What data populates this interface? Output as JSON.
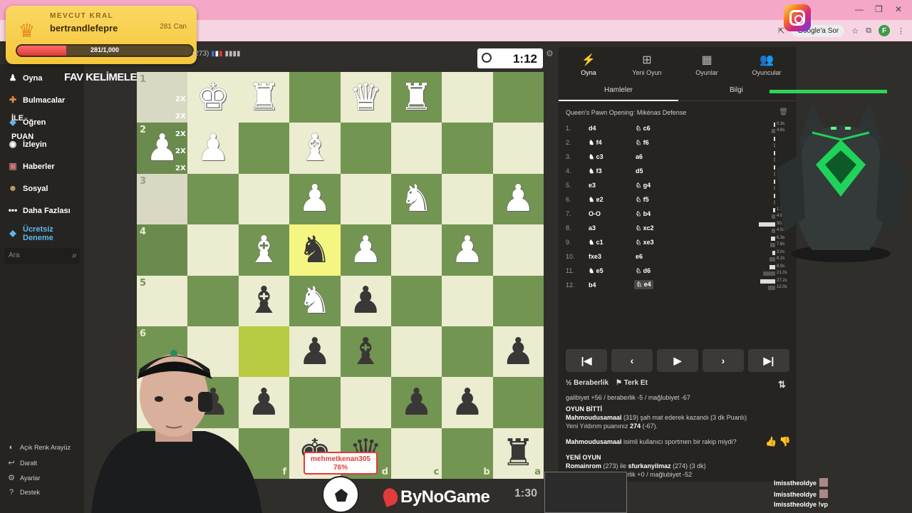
{
  "king_overlay": {
    "title": "MEVCUT KRAL",
    "name": "bertrandlefepre",
    "hp_label": "281 Can",
    "hp_text": "281/1,000",
    "hp_fraction": 0.281
  },
  "browser": {
    "ask_google": "Google'a Sor"
  },
  "sidebar": {
    "items": [
      {
        "label": "Oyna",
        "icon": "play-icon"
      },
      {
        "label": "Bulmacalar",
        "icon": "puzzle-icon"
      },
      {
        "label": "Öğren",
        "icon": "learn-icon"
      },
      {
        "label": "İzleyin",
        "icon": "watch-icon"
      },
      {
        "label": "Haberler",
        "icon": "news-icon"
      },
      {
        "label": "Sosyal",
        "icon": "social-icon"
      },
      {
        "label": "Daha Fazlası",
        "icon": "more-icon"
      }
    ],
    "trial": "Ücretsiz Deneme",
    "search_placeholder": "Ara",
    "bottom": [
      {
        "label": "Açık Renk Arayüz",
        "icon": "theme-icon"
      },
      {
        "label": "Daralt",
        "icon": "collapse-icon"
      },
      {
        "label": "Ayarlar",
        "icon": "settings-icon"
      },
      {
        "label": "Destek",
        "icon": "help-icon"
      }
    ]
  },
  "overlay_labels": {
    "fav": "FAV KELİMELER",
    "ile": "İLE",
    "puan": "PUAN"
  },
  "board_head": {
    "rating": "(273)"
  },
  "clock": {
    "time": "1:12"
  },
  "board": {
    "ranks": [
      "1",
      "2",
      "3",
      "4",
      "5",
      "6"
    ],
    "files": [
      "f",
      "d",
      "c",
      "b",
      "a"
    ],
    "multipliers": [
      "2X",
      "2X",
      "2X",
      "2X",
      "2X"
    ]
  },
  "panel": {
    "tabs": [
      {
        "label": "Oyna",
        "icon": "bolt-icon"
      },
      {
        "label": "Yeni Oyun",
        "icon": "plus-icon"
      },
      {
        "label": "Oyunlar",
        "icon": "board-icon"
      },
      {
        "label": "Oyuncular",
        "icon": "players-icon"
      }
    ],
    "subtabs": [
      "Hamleler",
      "Bilgi"
    ],
    "opening": "Queen's Pawn Opening: Mikėnas Defense",
    "moves": [
      {
        "n": "1.",
        "w": "d4",
        "b": "♘ c6",
        "tw": "0.3s",
        "tb": "4.8s"
      },
      {
        "n": "2.",
        "w": "♞ f4",
        "b": "♘ f6",
        "tw": "",
        "tb": ""
      },
      {
        "n": "3.",
        "w": "♞ c3",
        "b": "a6",
        "tw": "",
        "tb": ""
      },
      {
        "n": "4.",
        "w": "♞ f3",
        "b": "d5",
        "tw": "",
        "tb": ""
      },
      {
        "n": "5.",
        "w": "e3",
        "b": "♘ g4",
        "tw": "",
        "tb": ""
      },
      {
        "n": "6.",
        "w": "♞ e2",
        "b": "♘ f5",
        "tw": "",
        "tb": ""
      },
      {
        "n": "7.",
        "w": "O-O",
        "b": "♘ b4",
        "tw": "1.7s",
        "tb": "4.6s"
      },
      {
        "n": "8.",
        "w": "a3",
        "b": "♘ xc2",
        "tw": "30.5s",
        "tb": "4.5s"
      },
      {
        "n": "9.",
        "w": "♞ c1",
        "b": "♘ xe3",
        "tw": "6.3s",
        "tb": "7.6s"
      },
      {
        "n": "10.",
        "w": "fxe3",
        "b": "e6",
        "tw": "3.0s",
        "tb": "8.2s"
      },
      {
        "n": "11.",
        "w": "♞ e5",
        "b": "♘ d6",
        "tw": "8.9s",
        "tb": "21.0s"
      },
      {
        "n": "12.",
        "w": "b4",
        "b": "♘ e4",
        "tw": "27.2s",
        "tb": "12.0s"
      }
    ],
    "draw": "Beraberlik",
    "resign": "Terk Et",
    "chat": {
      "l1": "galibiyet +56 / beraberlik -5 / mağlubiyet -67",
      "l2": "OYUN BİTTİ",
      "l3a": "Mahmoudusamaal",
      "l3b": " (319) şah mat ederek kazandı (3 dk Puanlı)",
      "l4a": "Yeni Yıldırım puanınız ",
      "l4b": "274",
      "l4c": " (-67).",
      "l5a": "Mahmoudusamaal",
      "l5b": " isimli kullanıcı sportmen bir rakip miydi?",
      "l6": "YENİ OYUN",
      "l7a": "Romainrom",
      "l7b": " (273) ile ",
      "l7c": "sfurkanyilmaz",
      "l7d": " (274) (3 dk)",
      "l8": "galibiyet +52 / beraberlik +0 / mağlubiyet -52"
    }
  },
  "bottom": {
    "player_tag_name": "mehmetkenan305",
    "player_tag_pct": "76%",
    "brand": "ByNoGame",
    "time": "1:30",
    "stream_chat": [
      {
        "user": "Imisstheoldye",
        "msg": ""
      },
      {
        "user": "Imisstheoldye",
        "msg": ""
      },
      {
        "user": "Imisstheoldye",
        "msg": "!vp"
      }
    ]
  }
}
